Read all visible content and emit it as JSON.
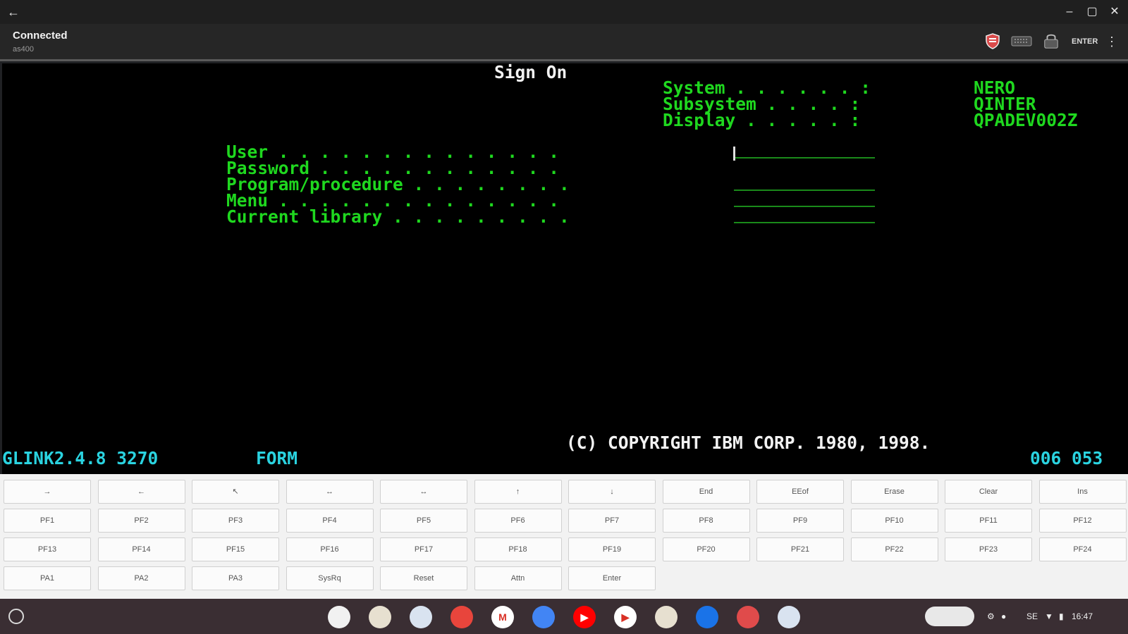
{
  "window": {
    "controls": {
      "back": "←",
      "minimize": "–",
      "maximize": "▢",
      "close": "✕"
    }
  },
  "toolbar": {
    "status": "Connected",
    "host": "as400",
    "icons": [
      "shield-icon",
      "keyboard-icon",
      "lock-icon"
    ],
    "enter_label": "ENTER",
    "more": "⋮"
  },
  "terminal": {
    "title": "Sign On",
    "info": [
      {
        "label": "System . . . . . . :",
        "value": "NERO"
      },
      {
        "label": "Subsystem . . . . :",
        "value": "QINTER"
      },
      {
        "label": "Display . . . . . :",
        "value": "QPADEV002Z"
      }
    ],
    "fields": [
      {
        "label": "User . . . . . . . . . . . . . .",
        "value": ""
      },
      {
        "label": "Password . . . . . . . . . . . .",
        "value": ""
      },
      {
        "label": "Program/procedure . . . . . . . .",
        "value": ""
      },
      {
        "label": "Menu . . . . . . . . . . . . . .",
        "value": ""
      },
      {
        "label": "Current library . . . . . . . . .",
        "value": ""
      }
    ],
    "copyright": "(C) COPYRIGHT IBM CORP. 1980, 1998.",
    "statusline": {
      "version": "GLINK2.4.8 3270",
      "mode": "FORM",
      "cursor_pos": "006 053"
    }
  },
  "keyboard": {
    "rows": [
      [
        "→",
        "←",
        "↖",
        "↔",
        "↔",
        "↑",
        "↓",
        "End",
        "EEof",
        "Erase",
        "Clear",
        "Ins"
      ],
      [
        "PF1",
        "PF2",
        "PF3",
        "PF4",
        "PF5",
        "PF6",
        "PF7",
        "PF8",
        "PF9",
        "PF10",
        "PF11",
        "PF12"
      ],
      [
        "PF13",
        "PF14",
        "PF15",
        "PF16",
        "PF17",
        "PF18",
        "PF19",
        "PF20",
        "PF21",
        "PF22",
        "PF23",
        "PF24"
      ],
      [
        "PA1",
        "PA2",
        "PA3",
        "SysRq",
        "Reset",
        "Attn",
        "Enter"
      ]
    ]
  },
  "shelf": {
    "apps": [
      {
        "name": "settings-app-icon",
        "color": "#f1f1f1",
        "glyph": ""
      },
      {
        "name": "glink-app-icon-1",
        "color": "#e7e0d0",
        "glyph": ""
      },
      {
        "name": "glink-app-icon-2",
        "color": "#d9e3f0",
        "glyph": ""
      },
      {
        "name": "chrome-icon",
        "color": "#e8453c",
        "glyph": ""
      },
      {
        "name": "gmail-icon",
        "color": "#ffffff",
        "glyph": "M"
      },
      {
        "name": "docs-icon",
        "color": "#4285f4",
        "glyph": ""
      },
      {
        "name": "youtube-icon",
        "color": "#ff0000",
        "glyph": "▶"
      },
      {
        "name": "play-store-icon",
        "color": "#ffffff",
        "glyph": "▶"
      },
      {
        "name": "glink-app-icon-3",
        "color": "#e7e0d0",
        "glyph": ""
      },
      {
        "name": "files-icon",
        "color": "#1a73e8",
        "glyph": ""
      },
      {
        "name": "screen-recorder-icon",
        "color": "#e04b4b",
        "glyph": ""
      },
      {
        "name": "glink-app-icon-4",
        "color": "#d9e3f0",
        "glyph": ""
      }
    ],
    "status": {
      "network": "SE",
      "time": "16:47"
    }
  },
  "colors": {
    "terminal_green": "#1fd81f",
    "terminal_cyan": "#2ad3e0",
    "terminal_white": "#f2f2f2",
    "terminal_bg": "#000000"
  }
}
